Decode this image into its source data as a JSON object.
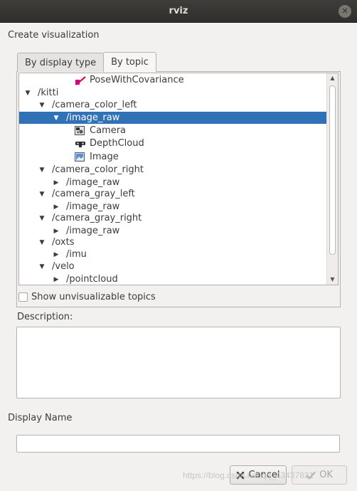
{
  "window": {
    "title": "rviz",
    "close_glyph": "✕"
  },
  "dialog": {
    "create_label": "Create visualization",
    "tabs": [
      {
        "label": "By display type",
        "active": false
      },
      {
        "label": "By topic",
        "active": true
      }
    ],
    "tree": [
      {
        "text": "PoseWithCovariance",
        "depth": 2,
        "arrow": "",
        "icon": "pose-icon"
      },
      {
        "text": "/kitti",
        "depth": 0,
        "arrow": "expanded"
      },
      {
        "text": "/camera_color_left",
        "depth": 1,
        "arrow": "expanded"
      },
      {
        "text": "/image_raw",
        "depth": 2,
        "arrow": "expanded",
        "selected": true
      },
      {
        "text": "Camera",
        "depth": 3,
        "arrow": "",
        "icon": "camera-icon"
      },
      {
        "text": "DepthCloud",
        "depth": 3,
        "arrow": "",
        "icon": "depthcloud-icon"
      },
      {
        "text": "Image",
        "depth": 3,
        "arrow": "",
        "icon": "image-icon"
      },
      {
        "text": "/camera_color_right",
        "depth": 1,
        "arrow": "expanded"
      },
      {
        "text": "/image_raw",
        "depth": 2,
        "arrow": "collapsed"
      },
      {
        "text": "/camera_gray_left",
        "depth": 1,
        "arrow": "expanded"
      },
      {
        "text": "/image_raw",
        "depth": 2,
        "arrow": "collapsed"
      },
      {
        "text": "/camera_gray_right",
        "depth": 1,
        "arrow": "expanded"
      },
      {
        "text": "/image_raw",
        "depth": 2,
        "arrow": "collapsed"
      },
      {
        "text": "/oxts",
        "depth": 1,
        "arrow": "expanded"
      },
      {
        "text": "/imu",
        "depth": 2,
        "arrow": "collapsed"
      },
      {
        "text": "/velo",
        "depth": 1,
        "arrow": "expanded"
      },
      {
        "text": "/pointcloud",
        "depth": 2,
        "arrow": "collapsed"
      }
    ],
    "show_unvisualizable_label": "Show unvisualizable topics",
    "show_unvisualizable_checked": false,
    "description_label": "Description:",
    "description_value": "",
    "display_name_label": "Display Name",
    "display_name_value": "",
    "cancel_label": "Cancel",
    "ok_label": "OK",
    "ok_enabled": false
  },
  "watermark": "https://blog.csdn.net/qq_43437831",
  "colors": {
    "selection": "#3072b5",
    "titlebar": "#2f2e2b",
    "background": "#f2f1f0"
  }
}
